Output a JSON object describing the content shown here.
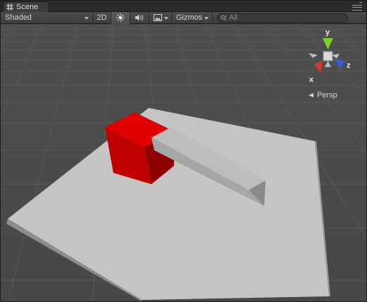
{
  "tab": {
    "title": "Scene"
  },
  "toolbar": {
    "render_mode": "Shaded",
    "mode_2d": "2D",
    "gizmos": "Gizmos",
    "search_placeholder": "All"
  },
  "gizmo": {
    "axis_y": "y",
    "axis_z": "z",
    "axis_x": "x",
    "projection": "Persp"
  },
  "colors": {
    "grid_background": "#474747",
    "plane": "#c4c4c4",
    "cube_front": "#c00000",
    "cube_top": "#e00000",
    "beam": "#a6a6a6",
    "axis_x": "#d83a2a",
    "axis_y": "#7cd21e",
    "axis_z": "#2c62e0"
  },
  "icons": [
    "scene-grid-icon",
    "lighting-sun-icon",
    "audio-speaker-icon",
    "image-effects-icon",
    "search-magnifier-icon",
    "panel-menu-icon"
  ]
}
